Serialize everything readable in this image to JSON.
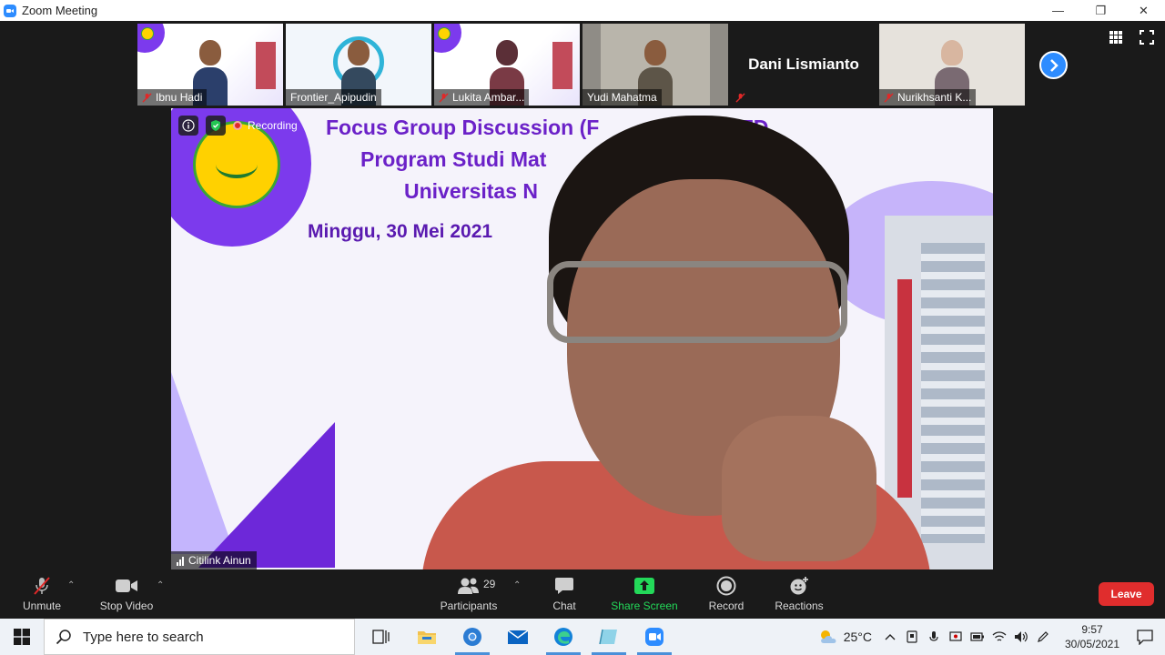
{
  "window": {
    "title": "Zoom Meeting",
    "controls": {
      "minimize": "—",
      "restore": "❐",
      "close": "✕"
    }
  },
  "gallery": {
    "participants": [
      {
        "name": "Ibnu Hadi",
        "muted": true
      },
      {
        "name": "Frontier_Apipudin",
        "muted": false
      },
      {
        "name": "Lukita Ambar...",
        "muted": true
      },
      {
        "name": "Yudi Mahatma",
        "muted": false
      },
      {
        "name": "Dani Lismianto",
        "muted": true
      },
      {
        "name": "Nurikhsanti K...",
        "muted": true
      }
    ]
  },
  "main_video": {
    "slide": {
      "line1": "Focus Group Discussion (F",
      "line1_end": "SFD",
      "line2": "Program Studi Mat",
      "line3": "Universitas N",
      "date": "Minggu, 30 Mei 2021"
    },
    "recording_label": "Recording",
    "speaker_name": "Citilink Ainun"
  },
  "toolbar": {
    "unmute_label": "Unmute",
    "stop_video_label": "Stop Video",
    "participants_label": "Participants",
    "participants_count": "29",
    "chat_label": "Chat",
    "share_screen_label": "Share Screen",
    "record_label": "Record",
    "reactions_label": "Reactions",
    "leave_label": "Leave"
  },
  "taskbar": {
    "search_placeholder": "Type here to search",
    "weather_temp": "25°C",
    "time": "9:57",
    "date": "30/05/2021"
  },
  "colors": {
    "zoom_blue": "#2d8cff",
    "share_green": "#23d959",
    "leave_red": "#e02d2d",
    "slide_purple": "#6b21c8"
  }
}
